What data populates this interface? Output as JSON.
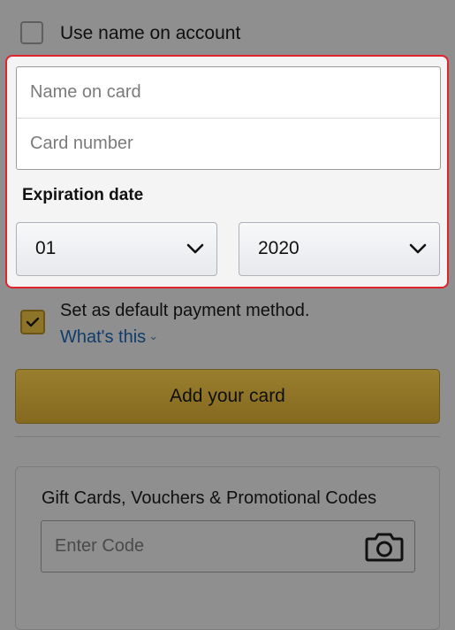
{
  "account_option": {
    "label": "Use name on account",
    "checked": false
  },
  "card_form": {
    "name_placeholder": "Name on card",
    "number_placeholder": "Card number",
    "expiration_label": "Expiration date",
    "month": "01",
    "year": "2020"
  },
  "default_payment": {
    "label": "Set as default payment method.",
    "checked": true,
    "help_link": "What's this"
  },
  "add_card_button": "Add your card",
  "gift_cards": {
    "title": "Gift Cards, Vouchers & Promotional Codes",
    "input_placeholder": "Enter Code"
  },
  "icons": {
    "dropdown": "chevron-down-icon",
    "camera": "camera-icon",
    "check": "checkmark-icon"
  },
  "colors": {
    "highlight_border": "#e0242e",
    "primary_button": "#9a7f2f",
    "link": "#0f3c6c",
    "overlay": "#8f8f8f"
  }
}
